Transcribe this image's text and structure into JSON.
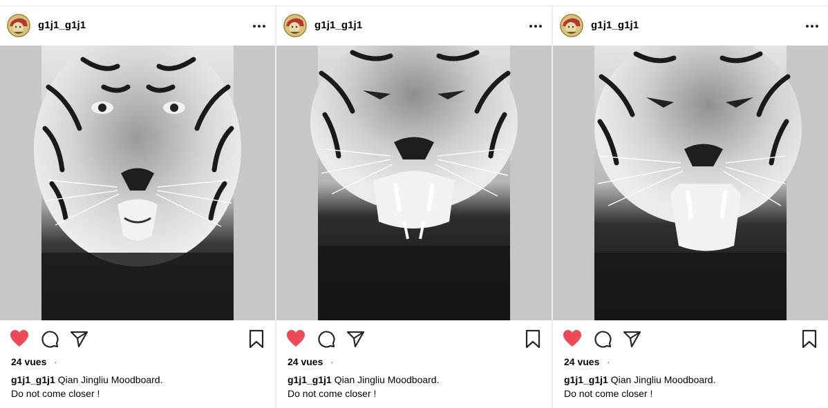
{
  "posts": [
    {
      "username": "g1j1_g1j1",
      "views": "24 vues",
      "dot": "·",
      "caption_user": "g1j1_g1j1",
      "caption_text": "Qian Jingliu Moodboard.",
      "caption_line2": "Do not come closer !",
      "liked": true,
      "media_icon": "tiger-photo"
    },
    {
      "username": "g1j1_g1j1",
      "views": "24 vues",
      "dot": "·",
      "caption_user": "g1j1_g1j1",
      "caption_text": "Qian Jingliu Moodboard.",
      "caption_line2": "Do not come closer !",
      "liked": true,
      "media_icon": "tiger-roaring-photo"
    },
    {
      "username": "g1j1_g1j1",
      "views": "24 vues",
      "dot": "·",
      "caption_user": "g1j1_g1j1",
      "caption_text": "Qian Jingliu Moodboard.",
      "caption_line2": "Do not come closer !",
      "liked": true,
      "media_icon": "tiger-snarling-photo"
    }
  ],
  "colors": {
    "like_red": "#ed4956",
    "icon_dark": "#262626",
    "media_side": "#c7c7c7"
  },
  "icons": [
    "more-icon",
    "heart-icon",
    "comment-icon",
    "share-icon",
    "bookmark-icon"
  ]
}
